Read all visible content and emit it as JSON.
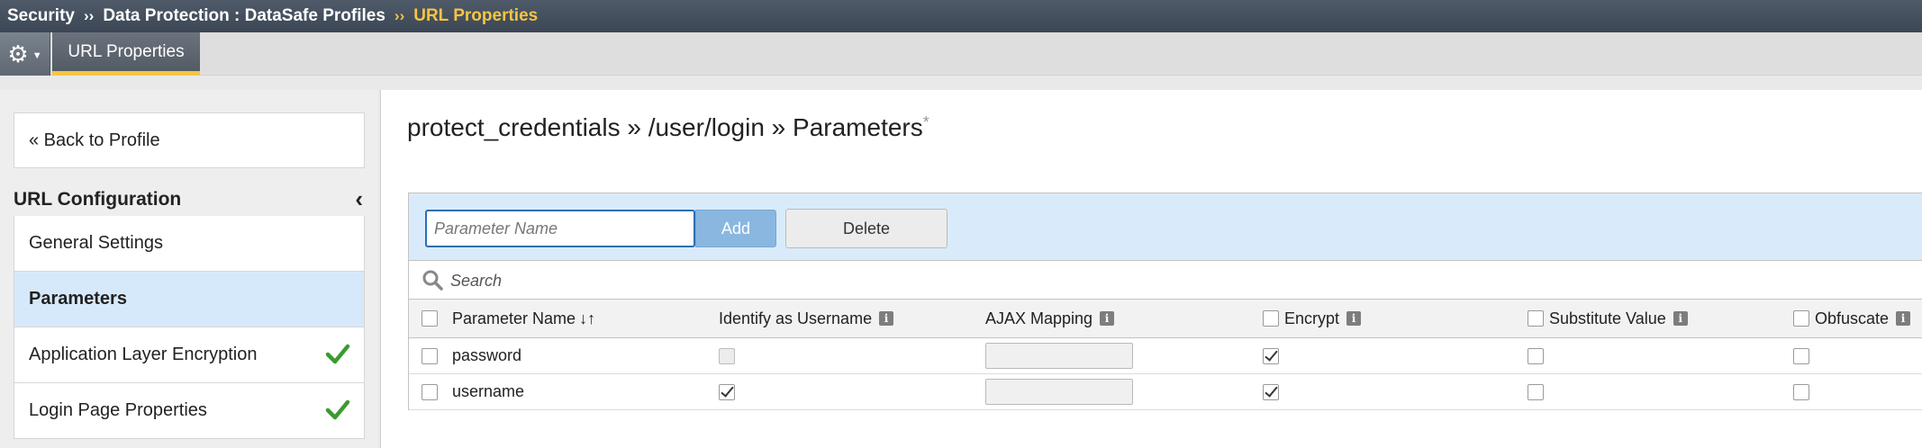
{
  "breadcrumb": {
    "items": [
      "Security",
      "Data Protection : DataSafe Profiles",
      "URL Properties"
    ],
    "separator": "››"
  },
  "tabbar": {
    "gear_icon": "gear-icon",
    "active_tab": "URL Properties"
  },
  "sidebar": {
    "back_label": "« Back to Profile",
    "section_title": "URL Configuration",
    "collapse_icon": "chevron-left-icon",
    "items": [
      {
        "label": "General Settings",
        "active": false,
        "check": false
      },
      {
        "label": "Parameters",
        "active": true,
        "check": false
      },
      {
        "label": "Application Layer Encryption",
        "active": false,
        "check": true
      },
      {
        "label": "Login Page Properties",
        "active": false,
        "check": true
      }
    ],
    "check_color": "#3a9b2e"
  },
  "main": {
    "title": "protect_credentials » /user/login » Parameters",
    "title_asterisk": "*",
    "toolbar": {
      "input_placeholder": "Parameter Name",
      "add_label": "Add",
      "delete_label": "Delete"
    },
    "search": {
      "placeholder": "Search"
    },
    "table": {
      "columns": [
        {
          "label": "Parameter Name",
          "sort_icon": "↓↑"
        },
        {
          "label": "Identify as Username",
          "info": "i"
        },
        {
          "label": "AJAX Mapping",
          "info": "i"
        },
        {
          "label": "Encrypt",
          "info": "i",
          "checkbox": true
        },
        {
          "label": "Substitute Value",
          "info": "i",
          "checkbox": true
        },
        {
          "label": "Obfuscate",
          "info": "i",
          "checkbox": true
        }
      ],
      "rows": [
        {
          "name": "password",
          "identify_as_username": false,
          "identify_disabled": true,
          "ajax_mapping": "",
          "encrypt": true,
          "substitute": false,
          "obfuscate": false
        },
        {
          "name": "username",
          "identify_as_username": true,
          "identify_disabled": false,
          "ajax_mapping": "",
          "encrypt": true,
          "substitute": false,
          "obfuscate": false
        }
      ]
    }
  },
  "colors": {
    "header_bg": "#46505d",
    "highlight": "#f5c542",
    "active_nav_bg": "#d6e9fb",
    "toolbar_bg": "#d9ebfa",
    "add_button": "#8ab7e0"
  }
}
